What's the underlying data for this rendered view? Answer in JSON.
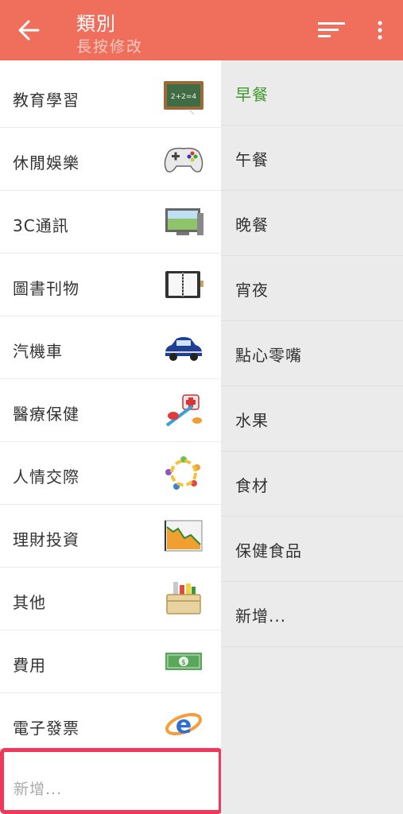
{
  "header": {
    "title": "類別",
    "subtitle": "長按修改",
    "back_icon": "arrow-left-icon",
    "sort_icon": "sort-icon",
    "more_icon": "more-vert-icon"
  },
  "colors": {
    "appbar": "#ef6f5c",
    "selected_text": "#3f9a2e",
    "highlight_border": "#f2385a"
  },
  "categories": [
    {
      "label": "教育學習",
      "icon": "chalkboard-icon"
    },
    {
      "label": "休閒娛樂",
      "icon": "gamepad-icon"
    },
    {
      "label": "3C通訊",
      "icon": "monitor-icon"
    },
    {
      "label": "圖書刊物",
      "icon": "notebook-icon"
    },
    {
      "label": "汽機車",
      "icon": "car-icon"
    },
    {
      "label": "醫療保健",
      "icon": "medical-icon"
    },
    {
      "label": "人情交際",
      "icon": "people-circle-icon"
    },
    {
      "label": "理財投資",
      "icon": "stock-chart-icon"
    },
    {
      "label": "其他",
      "icon": "supply-box-icon"
    },
    {
      "label": "費用",
      "icon": "money-icon"
    },
    {
      "label": "電子發票",
      "icon": "e-invoice-icon"
    }
  ],
  "add_category_label": "新增...",
  "subcategories": [
    {
      "label": "早餐",
      "selected": true
    },
    {
      "label": "午餐"
    },
    {
      "label": "晚餐"
    },
    {
      "label": "宵夜"
    },
    {
      "label": "點心零嘴"
    },
    {
      "label": "水果"
    },
    {
      "label": "食材"
    },
    {
      "label": "保健食品"
    },
    {
      "label": "新增..."
    }
  ]
}
